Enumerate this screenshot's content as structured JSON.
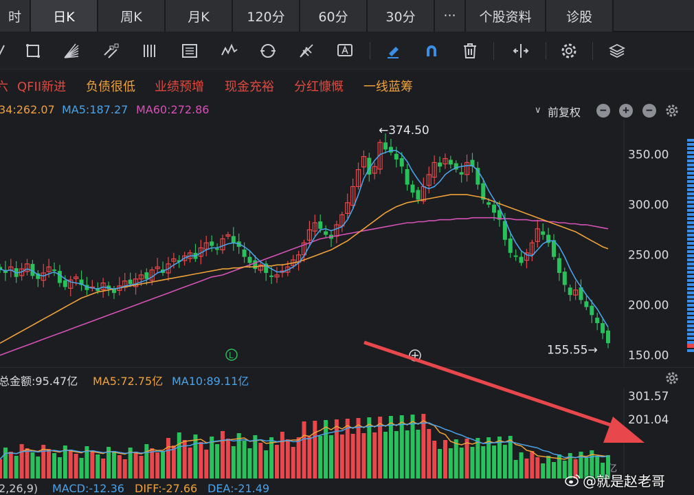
{
  "tabs": [
    {
      "label": "时"
    },
    {
      "label": "日K",
      "active": true
    },
    {
      "label": "周K"
    },
    {
      "label": "月K"
    },
    {
      "label": "120分"
    },
    {
      "label": "60分"
    },
    {
      "label": "30分"
    },
    {
      "label": "···"
    },
    {
      "label": "个股资料"
    },
    {
      "label": "诊股"
    }
  ],
  "toolbar": {
    "icons": [
      "line-tool-icon",
      "rectangle-tool-icon",
      "fan-tool-icon",
      "channel-tool-icon",
      "vertical-lines-icon",
      "gann-grid-icon",
      "wave-tool-icon",
      "cycle-tool-icon",
      "fib-fan-icon",
      "text-label-icon",
      "highlighter-icon",
      "magnet-icon",
      "trash-icon",
      "split-view-icon",
      "settings-icon",
      "layers-icon"
    ]
  },
  "tags": [
    {
      "text": "六",
      "color": "#e0493f"
    },
    {
      "text": "QFII新进",
      "color": "#e0493f"
    },
    {
      "text": "负债很低",
      "color": "#f0a23a"
    },
    {
      "text": "业绩预增",
      "color": "#e0493f"
    },
    {
      "text": "现金充裕",
      "color": "#e0493f"
    },
    {
      "text": "分红慷慨",
      "color": "#e0493f"
    },
    {
      "text": "一线蓝筹",
      "color": "#f0a23a"
    }
  ],
  "ma_header": {
    "ma_a": "34:262.07",
    "ma5": "MA5:187.27",
    "ma60": "MA60:272.86",
    "adjust": "前复权",
    "colors": {
      "ma_a": "#f0a23a",
      "ma5": "#4aa3e8",
      "ma60": "#d552b6"
    }
  },
  "price_axis": [
    "350.00",
    "300.00",
    "250.00",
    "200.00",
    "150.00"
  ],
  "price_range": [
    145,
    382
  ],
  "annotations": {
    "high": "←374.50",
    "low": "155.55→",
    "l_marker": "L"
  },
  "volume_header": {
    "total": "总金额:95.47亿",
    "ma5": "MA5:72.75亿",
    "ma10": "MA10:89.11亿"
  },
  "volume_axis": [
    "301.57",
    "201.04"
  ],
  "volume_unit": "亿",
  "macd": {
    "params": "2,26,9)",
    "macd": "MACD:-12.36",
    "diff": "DIFF:-27.66",
    "dea": "DEA:-21.49"
  },
  "watermark": "@就是赵老哥",
  "colors": {
    "up": "#e8474b",
    "down": "#29c15c",
    "ma5": "#4aa3e8",
    "ma_orange": "#f0a23a",
    "ma60": "#d552b6",
    "arrow": "#e8474b"
  },
  "chart_data": {
    "type": "candlestick",
    "y_range": [
      145,
      382
    ],
    "notable": {
      "high": 374.5,
      "low": 155.55
    },
    "closes": [
      235,
      232,
      238,
      228,
      236,
      241,
      229,
      226,
      232,
      238,
      234,
      222,
      218,
      225,
      228,
      220,
      215,
      218,
      214,
      222,
      216,
      212,
      219,
      224,
      221,
      226,
      230,
      226,
      235,
      238,
      232,
      241,
      246,
      243,
      249,
      252,
      246,
      257,
      262,
      259,
      255,
      266,
      270,
      262,
      258,
      248,
      242,
      236,
      240,
      232,
      228,
      230,
      234,
      238,
      245,
      250,
      262,
      275,
      282,
      276,
      270,
      266,
      280,
      290,
      302,
      318,
      335,
      348,
      330,
      338,
      362,
      355,
      352,
      345,
      338,
      320,
      312,
      305,
      318,
      330,
      342,
      338,
      346,
      340,
      335,
      330,
      342,
      338,
      320,
      305,
      300,
      292,
      285,
      265,
      252,
      248,
      242,
      252,
      262,
      276,
      270,
      262,
      248,
      232,
      220,
      210,
      215,
      205,
      198,
      190,
      182,
      172,
      162
    ],
    "ma5": [
      236,
      234,
      235,
      232,
      233,
      236,
      234,
      230,
      229,
      231,
      233,
      230,
      226,
      223,
      222,
      221,
      218,
      217,
      216,
      218,
      217,
      216,
      217,
      219,
      220,
      221,
      223,
      225,
      228,
      232,
      234,
      236,
      240,
      243,
      247,
      249,
      249,
      252,
      255,
      257,
      257,
      259,
      261,
      262,
      261,
      258,
      254,
      248,
      243,
      239,
      236,
      233,
      233,
      235,
      238,
      242,
      249,
      259,
      268,
      275,
      276,
      274,
      276,
      278,
      285,
      296,
      310,
      326,
      336,
      344,
      350,
      352,
      354,
      354,
      350,
      343,
      333,
      325,
      318,
      316,
      318,
      323,
      330,
      334,
      337,
      338,
      339,
      339,
      334,
      325,
      314,
      305,
      297,
      285,
      272,
      262,
      254,
      250,
      249,
      255,
      261,
      264,
      264,
      258,
      248,
      236,
      226,
      218,
      210,
      203,
      196,
      187,
      178
    ],
    "ma_orange": [
      162,
      165,
      168,
      171,
      174,
      177,
      180,
      183,
      186,
      189,
      192,
      195,
      198,
      201,
      204,
      207,
      209,
      211,
      213,
      214,
      215,
      216,
      217,
      218,
      219,
      220,
      221,
      222,
      223,
      224,
      225,
      226,
      227,
      228,
      229,
      230,
      231,
      232,
      233,
      234,
      235,
      236,
      236,
      237,
      237,
      238,
      238,
      238,
      239,
      239,
      239,
      240,
      240,
      241,
      242,
      243,
      245,
      247,
      249,
      251,
      253,
      255,
      258,
      261,
      264,
      268,
      272,
      276,
      280,
      284,
      288,
      292,
      295,
      298,
      300,
      302,
      303,
      304,
      305,
      306,
      307,
      308,
      309,
      310,
      310,
      310,
      310,
      309,
      308,
      307,
      305,
      303,
      301,
      299,
      297,
      295,
      293,
      291,
      289,
      287,
      285,
      283,
      281,
      279,
      277,
      275,
      273,
      270,
      267,
      264,
      261,
      258,
      256
    ],
    "ma60": [
      150,
      152,
      154,
      156,
      158,
      160,
      162,
      164,
      166,
      168,
      170,
      172,
      174,
      176,
      178,
      180,
      182,
      184,
      186,
      188,
      190,
      192,
      194,
      196,
      198,
      200,
      202,
      204,
      206,
      208,
      210,
      212,
      214,
      216,
      218,
      220,
      222,
      224,
      226,
      228,
      229,
      230,
      232,
      234,
      236,
      238,
      240,
      242,
      244,
      246,
      248,
      250,
      252,
      254,
      256,
      258,
      260,
      262,
      264,
      266,
      267,
      268,
      269,
      270,
      271,
      272,
      273,
      274,
      275,
      276,
      277,
      278,
      279,
      280,
      281,
      282,
      282,
      283,
      283,
      284,
      284,
      285,
      285,
      285,
      286,
      286,
      286,
      287,
      287,
      287,
      287,
      287,
      286,
      286,
      286,
      285,
      285,
      285,
      284,
      284,
      284,
      283,
      283,
      282,
      282,
      281,
      281,
      280,
      280,
      279,
      278,
      277,
      276
    ]
  }
}
